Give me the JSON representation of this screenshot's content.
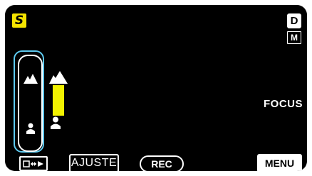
{
  "status": {
    "mode_letter": "S",
    "mode_color": "#f5e400",
    "battery_letter": "D",
    "manual_letter": "M"
  },
  "focus_slider": {
    "far_icon": "mountain-icon",
    "near_icon": "person-icon",
    "outline_color": "#5ec9ef"
  },
  "focus_level": {
    "bar_color": "#f2f200",
    "top_icon": "mountain-icon",
    "bottom_icon": "person-icon"
  },
  "focus_label": "FOCUS",
  "bottom_bar": {
    "switch_icon": "display-switch-icon",
    "ajuste_label": "AJUSTE",
    "rec_label": "REC",
    "menu_label": "MENU"
  }
}
